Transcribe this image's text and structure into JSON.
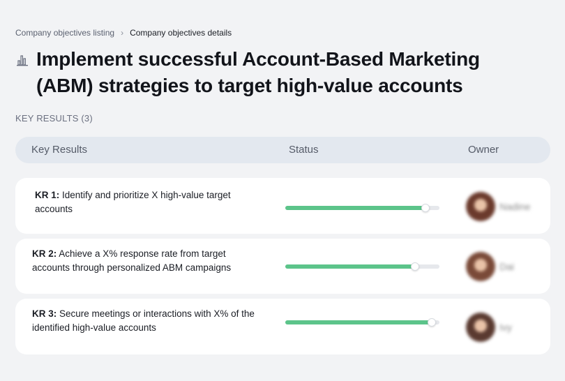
{
  "breadcrumb": {
    "parent": "Company objectives listing",
    "separator": "›",
    "current": "Company objectives details"
  },
  "objective": {
    "icon": "bar-chart-icon",
    "title": "Implement successful Account-Based Marketing (ABM) strategies to target high-value accounts"
  },
  "key_results_heading": "KEY RESULTS (3)",
  "table": {
    "columns": [
      "Key Results",
      "Status",
      "Owner"
    ]
  },
  "key_results": [
    {
      "label": "KR 1:",
      "text": " Identify and prioritize X high-value target accounts",
      "progress": 0.91,
      "owner": "Nadine",
      "avatar_color": "#6b3a2c"
    },
    {
      "label": "KR 2:",
      "text": " Achieve a X% response rate from target accounts through personalized ABM campaigns",
      "progress": 0.84,
      "owner": "Dai",
      "avatar_color": "#7a4a38"
    },
    {
      "label": "KR 3:",
      "text": " Secure meetings or interactions with X% of the identified high-value accounts",
      "progress": 0.95,
      "owner": "Ivy",
      "avatar_color": "#5a3a30"
    }
  ],
  "colors": {
    "background": "#f2f3f5",
    "header_bg": "#e3e8ef",
    "progress_fill": "#5cc48a",
    "progress_track": "#e6e8ec"
  }
}
